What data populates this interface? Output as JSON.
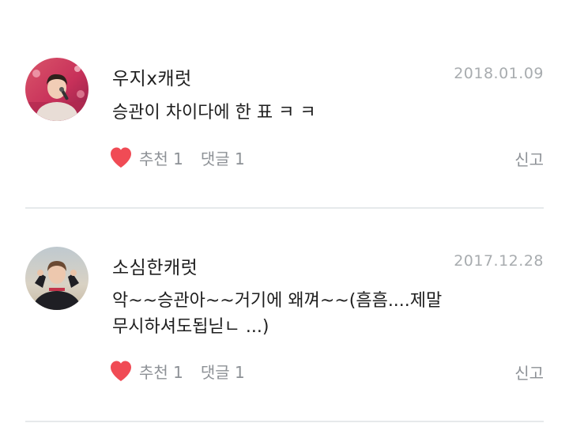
{
  "comments": [
    {
      "username": "우지x캐럿",
      "date": "2018.01.09",
      "text": "승관이 차이다에 한 표 ㅋ ㅋ",
      "likes": "추천 1",
      "replies": "댓글 1",
      "report": "신고",
      "avatar": "profile-photo"
    },
    {
      "username": "소심한캐럿",
      "date": "2017.12.28",
      "text": "악~~승관아~~거기에 왜껴~~(흠흠....제말\n무시하셔도됩닏ㄴ ...)",
      "likes": "추천 1",
      "replies": "댓글 1",
      "report": "신고",
      "avatar": "profile-photo"
    }
  ],
  "colors": {
    "heart": "#f04b55",
    "muted_text": "#8d9196",
    "date_text": "#a8acaf",
    "divider": "#e6e9eb"
  }
}
